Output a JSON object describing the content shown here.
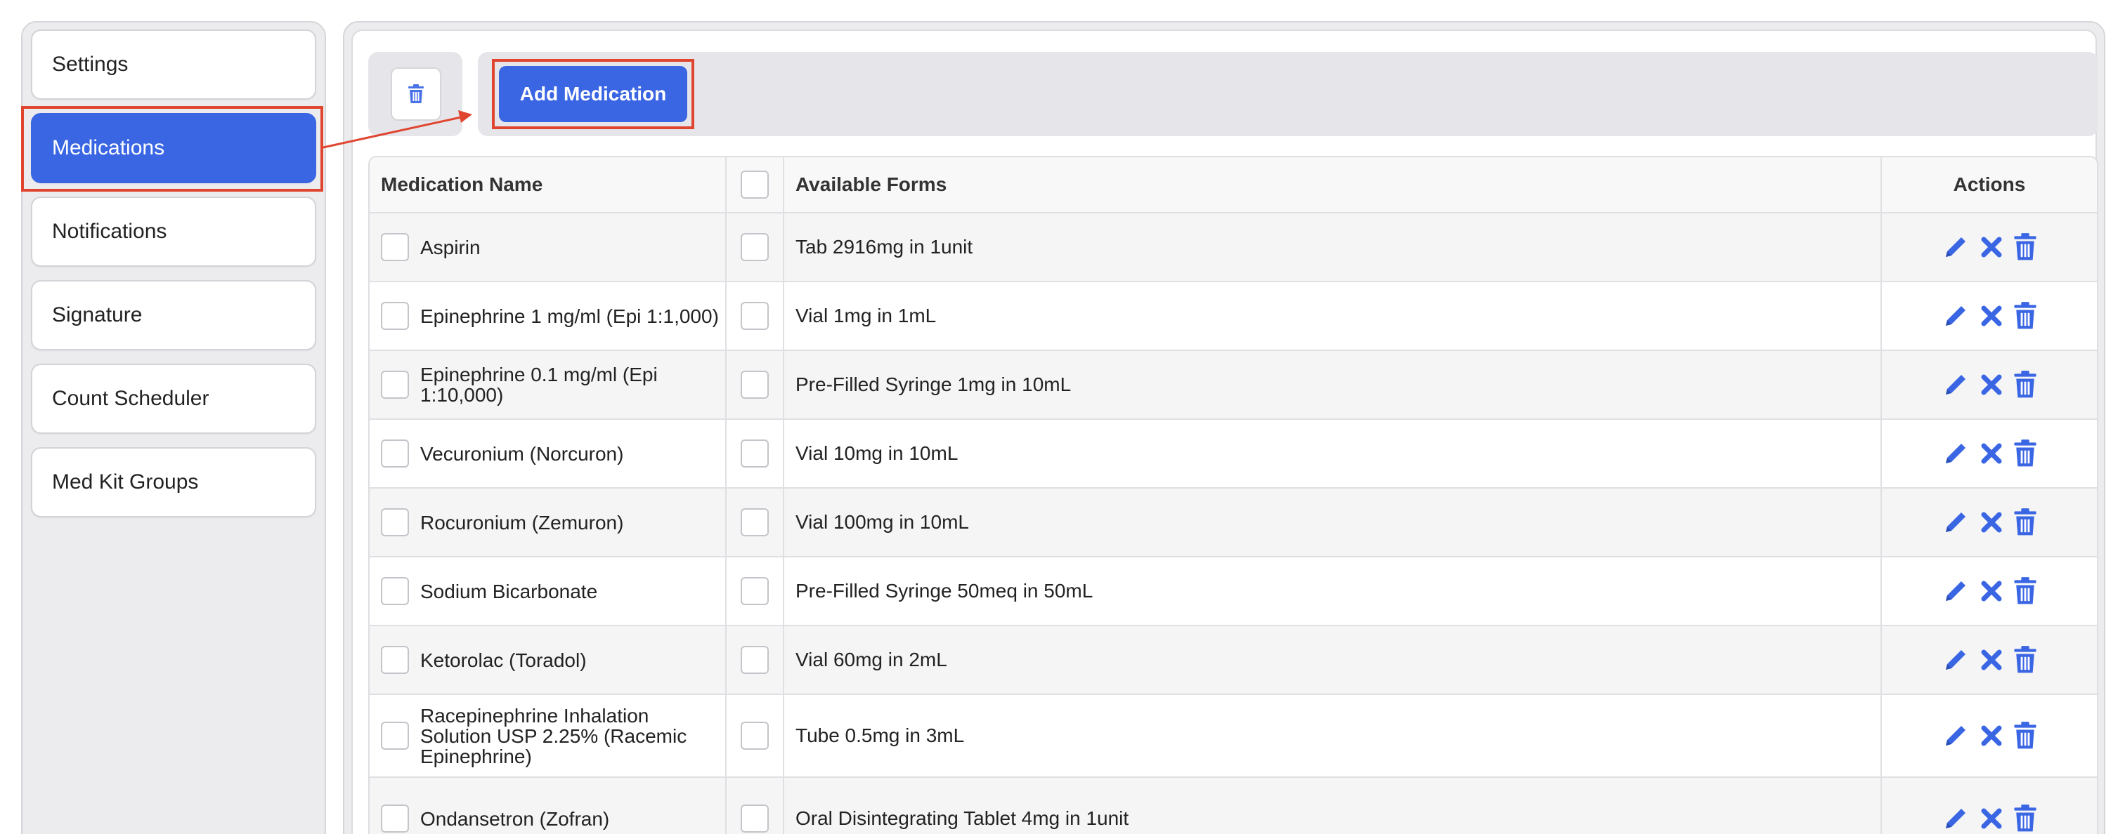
{
  "sidebar": {
    "items": [
      {
        "label": "Settings",
        "active": false
      },
      {
        "label": "Medications",
        "active": true
      },
      {
        "label": "Notifications",
        "active": false
      },
      {
        "label": "Signature",
        "active": false
      },
      {
        "label": "Count Scheduler",
        "active": false
      },
      {
        "label": "Med Kit Groups",
        "active": false
      }
    ]
  },
  "toolbar": {
    "add_label": "Add Medication",
    "delete_icon": "trash-icon"
  },
  "table": {
    "columns": [
      "Medication Name",
      "",
      "Available Forms",
      "Actions"
    ],
    "action_icons": [
      "pencil-icon",
      "x-icon",
      "trash-icon"
    ],
    "rows": [
      {
        "name": "Aspirin",
        "form": "Tab 2916mg in 1unit"
      },
      {
        "name": "Epinephrine 1 mg/ml (Epi 1:1,000)",
        "form": "Vial 1mg in 1mL"
      },
      {
        "name": "Epinephrine 0.1 mg/ml (Epi 1:10,000)",
        "form": "Pre-Filled Syringe 1mg in 10mL"
      },
      {
        "name": "Vecuronium (Norcuron)",
        "form": "Vial 10mg in 10mL"
      },
      {
        "name": "Rocuronium (Zemuron)",
        "form": "Vial 100mg in 10mL"
      },
      {
        "name": "Sodium Bicarbonate",
        "form": "Pre-Filled Syringe 50meq in 50mL"
      },
      {
        "name": "Ketorolac (Toradol)",
        "form": "Vial 60mg in 2mL"
      },
      {
        "name": "Racepinephrine Inhalation Solution USP 2.25% (Racemic Epinephrine)",
        "form": "Tube 0.5mg in 3mL"
      },
      {
        "name": "Ondansetron (Zofran)",
        "form": "Oral Disintegrating Tablet 4mg in 1unit"
      }
    ]
  },
  "colors": {
    "accent": "#3a66e4",
    "highlight": "#e04530"
  }
}
